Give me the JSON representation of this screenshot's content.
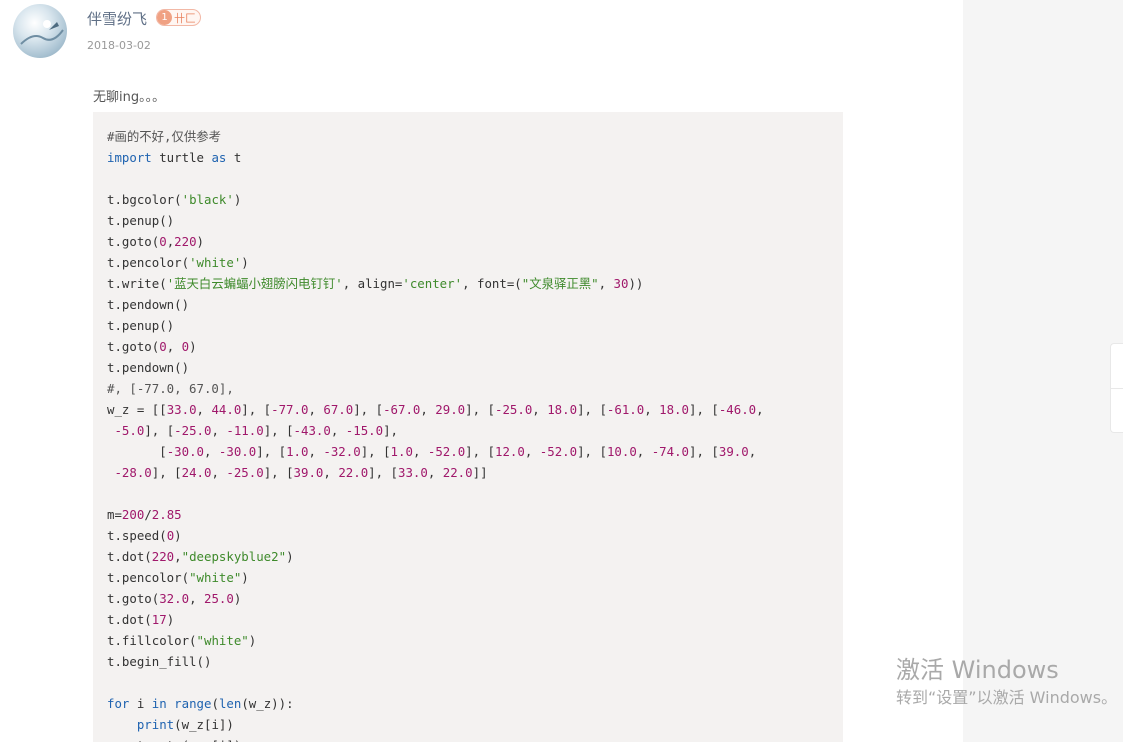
{
  "author": {
    "name": "伴雪纷飞",
    "level": "1",
    "level_title": "卄匚"
  },
  "date": "2018-03-02",
  "post_text": "无聊ing。。。",
  "code_lines": [
    [
      [
        "cm",
        "#画的不好,仅供参考"
      ]
    ],
    [
      [
        "kw",
        "import"
      ],
      [
        "",
        " turtle "
      ],
      [
        "kw",
        "as"
      ],
      [
        "",
        " t"
      ]
    ],
    [],
    [
      [
        "",
        "t.bgcolor("
      ],
      [
        "str",
        "'black'"
      ],
      [
        "",
        ")"
      ]
    ],
    [
      [
        "",
        "t.penup()"
      ]
    ],
    [
      [
        "",
        "t.goto("
      ],
      [
        "num",
        "0"
      ],
      [
        "",
        ","
      ],
      [
        "num",
        "220"
      ],
      [
        "",
        ")"
      ]
    ],
    [
      [
        "",
        "t.pencolor("
      ],
      [
        "str",
        "'white'"
      ],
      [
        "",
        ")"
      ]
    ],
    [
      [
        "",
        "t.write("
      ],
      [
        "str",
        "'蓝天白云蝙蝠小翅膀闪电钉钉'"
      ],
      [
        "",
        ", align="
      ],
      [
        "str",
        "'center'"
      ],
      [
        "",
        ", font=("
      ],
      [
        "str",
        "\"文泉驿正黑\""
      ],
      [
        "",
        ", "
      ],
      [
        "num",
        "30"
      ],
      [
        "",
        "))"
      ]
    ],
    [
      [
        "",
        "t.pendown()"
      ]
    ],
    [
      [
        "",
        "t.penup()"
      ]
    ],
    [
      [
        "",
        "t.goto("
      ],
      [
        "num",
        "0"
      ],
      [
        "",
        ", "
      ],
      [
        "num",
        "0"
      ],
      [
        "",
        ")"
      ]
    ],
    [
      [
        "",
        "t.pendown()"
      ]
    ],
    [
      [
        "cm",
        "#, [-77.0, 67.0],"
      ]
    ],
    [
      [
        "",
        "w_z = [["
      ],
      [
        "num",
        "33.0"
      ],
      [
        "",
        ", "
      ],
      [
        "num",
        "44.0"
      ],
      [
        "",
        "], ["
      ],
      [
        "num",
        "-77.0"
      ],
      [
        "",
        ", "
      ],
      [
        "num",
        "67.0"
      ],
      [
        "",
        "], ["
      ],
      [
        "num",
        "-67.0"
      ],
      [
        "",
        ", "
      ],
      [
        "num",
        "29.0"
      ],
      [
        "",
        "], ["
      ],
      [
        "num",
        "-25.0"
      ],
      [
        "",
        ", "
      ],
      [
        "num",
        "18.0"
      ],
      [
        "",
        "], ["
      ],
      [
        "num",
        "-61.0"
      ],
      [
        "",
        ", "
      ],
      [
        "num",
        "18.0"
      ],
      [
        "",
        "], ["
      ],
      [
        "num",
        "-46.0"
      ],
      [
        "",
        ","
      ]
    ],
    [
      [
        "",
        " "
      ],
      [
        "num",
        "-5.0"
      ],
      [
        "",
        "], ["
      ],
      [
        "num",
        "-25.0"
      ],
      [
        "",
        ", "
      ],
      [
        "num",
        "-11.0"
      ],
      [
        "",
        "], ["
      ],
      [
        "num",
        "-43.0"
      ],
      [
        "",
        ", "
      ],
      [
        "num",
        "-15.0"
      ],
      [
        "",
        "],"
      ]
    ],
    [
      [
        "",
        "       ["
      ],
      [
        "num",
        "-30.0"
      ],
      [
        "",
        ", "
      ],
      [
        "num",
        "-30.0"
      ],
      [
        "",
        "], ["
      ],
      [
        "num",
        "1.0"
      ],
      [
        "",
        ", "
      ],
      [
        "num",
        "-32.0"
      ],
      [
        "",
        "], ["
      ],
      [
        "num",
        "1.0"
      ],
      [
        "",
        ", "
      ],
      [
        "num",
        "-52.0"
      ],
      [
        "",
        "], ["
      ],
      [
        "num",
        "12.0"
      ],
      [
        "",
        ", "
      ],
      [
        "num",
        "-52.0"
      ],
      [
        "",
        "], ["
      ],
      [
        "num",
        "10.0"
      ],
      [
        "",
        ", "
      ],
      [
        "num",
        "-74.0"
      ],
      [
        "",
        "], ["
      ],
      [
        "num",
        "39.0"
      ],
      [
        "",
        ","
      ]
    ],
    [
      [
        "",
        " "
      ],
      [
        "num",
        "-28.0"
      ],
      [
        "",
        "], ["
      ],
      [
        "num",
        "24.0"
      ],
      [
        "",
        ", "
      ],
      [
        "num",
        "-25.0"
      ],
      [
        "",
        "], ["
      ],
      [
        "num",
        "39.0"
      ],
      [
        "",
        ", "
      ],
      [
        "num",
        "22.0"
      ],
      [
        "",
        "], ["
      ],
      [
        "num",
        "33.0"
      ],
      [
        "",
        ", "
      ],
      [
        "num",
        "22.0"
      ],
      [
        "",
        "]]"
      ]
    ],
    [],
    [
      [
        "",
        "m="
      ],
      [
        "num",
        "200"
      ],
      [
        "",
        "/"
      ],
      [
        "num",
        "2.85"
      ]
    ],
    [
      [
        "",
        "t.speed("
      ],
      [
        "num",
        "0"
      ],
      [
        "",
        ")"
      ]
    ],
    [
      [
        "",
        "t.dot("
      ],
      [
        "num",
        "220"
      ],
      [
        "",
        ","
      ],
      [
        "str",
        "\"deepskyblue2\""
      ],
      [
        "",
        ")"
      ]
    ],
    [
      [
        "",
        "t.pencolor("
      ],
      [
        "str",
        "\"white\""
      ],
      [
        "",
        ")"
      ]
    ],
    [
      [
        "",
        "t.goto("
      ],
      [
        "num",
        "32.0"
      ],
      [
        "",
        ", "
      ],
      [
        "num",
        "25.0"
      ],
      [
        "",
        ")"
      ]
    ],
    [
      [
        "",
        "t.dot("
      ],
      [
        "num",
        "17"
      ],
      [
        "",
        ")"
      ]
    ],
    [
      [
        "",
        "t.fillcolor("
      ],
      [
        "str",
        "\"white\""
      ],
      [
        "",
        ")"
      ]
    ],
    [
      [
        "",
        "t.begin_fill()"
      ]
    ],
    [],
    [
      [
        "kw",
        "for"
      ],
      [
        "",
        " i "
      ],
      [
        "kw",
        "in"
      ],
      [
        "",
        " "
      ],
      [
        "kw",
        "range"
      ],
      [
        "",
        "("
      ],
      [
        "kw",
        "len"
      ],
      [
        "",
        "(w_z)):"
      ]
    ],
    [
      [
        "",
        "    "
      ],
      [
        "kw",
        "print"
      ],
      [
        "",
        "(w_z[i])"
      ]
    ],
    [
      [
        "",
        "    t.goto(w_z[i])"
      ]
    ]
  ],
  "watermark": {
    "title": "激活 Windows",
    "subtitle": "转到“设置”以激活 Windows。"
  },
  "colors": {
    "keyword": "#1f63b0",
    "string": "#3e8a2b",
    "number": "#a0186b",
    "code_bg": "#f4f2f1",
    "author": "#5f6f86"
  }
}
